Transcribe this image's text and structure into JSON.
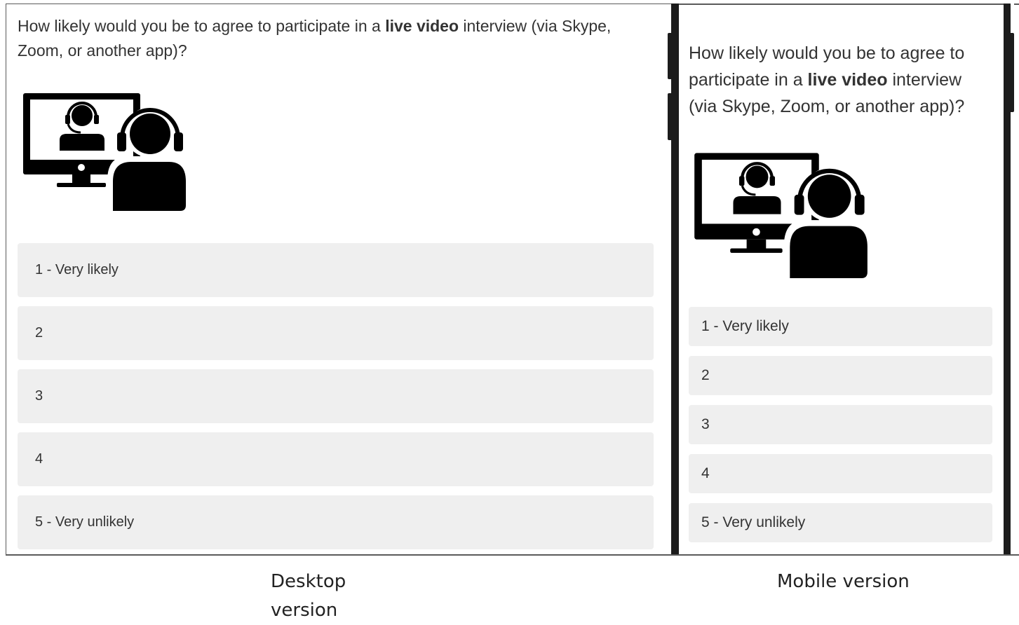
{
  "desktop": {
    "question_pre": "How likely would you be to agree to participate in a ",
    "question_bold": "live video",
    "question_post": " interview (via Skype, Zoom, or another app)?",
    "illustration_icon": "video-call-headset-icon",
    "options": [
      {
        "label": "1 - Very likely"
      },
      {
        "label": "2"
      },
      {
        "label": "3"
      },
      {
        "label": "4"
      },
      {
        "label": "5 - Very unlikely"
      }
    ]
  },
  "mobile": {
    "question_pre": "How likely would you be to agree to participate in a ",
    "question_bold": "live video",
    "question_post": " interview (via Skype, Zoom, or another app)?",
    "illustration_icon": "video-call-headset-icon",
    "options": [
      {
        "label": "1 - Very likely"
      },
      {
        "label": "2"
      },
      {
        "label": "3"
      },
      {
        "label": "4"
      },
      {
        "label": "5 - Very unlikely"
      }
    ]
  },
  "captions": {
    "desktop": "Desktop version",
    "mobile": "Mobile version"
  },
  "colors": {
    "option_background": "#efefef",
    "text": "#333333",
    "phone_frame": "#1c1c1c"
  }
}
